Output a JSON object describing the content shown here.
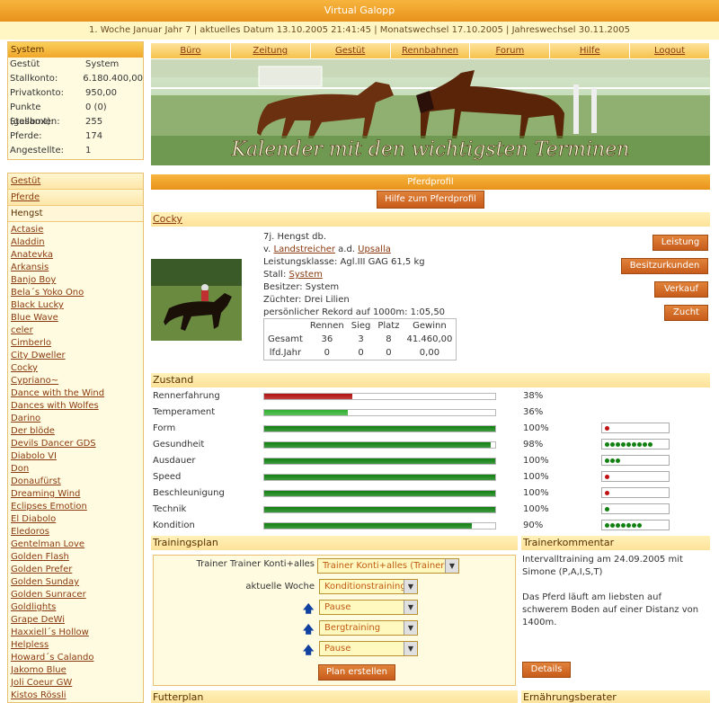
{
  "app": {
    "title": "Virtual Galopp",
    "datebar": "1. Woche Januar Jahr 7 | aktuelles Datum 13.10.2005 21:41:45 | Monatswechsel 17.10.2005 | Jahreswechsel 30.11.2005"
  },
  "system": {
    "title": "System",
    "rows": [
      {
        "label": "Gestüt",
        "value": "System"
      },
      {
        "label": "Stallkonto:",
        "value": "6.180.400,00"
      },
      {
        "label": "Privatkonto:",
        "value": "950,00"
      },
      {
        "label": "Punkte (gesamt):",
        "value": "0 (0)"
      },
      {
        "label": "Stallboxen:",
        "value": "255"
      },
      {
        "label": "Pferde:",
        "value": "174"
      },
      {
        "label": "Angestellte:",
        "value": "1"
      }
    ]
  },
  "nav": {
    "gestuet": "Gestüt",
    "pferde": "Pferde",
    "hengst": "Hengst",
    "horses": [
      "Actasie",
      "Aladdin",
      "Anatevka",
      "Arkansis",
      "Banjo Boy",
      "Bela´s Yoko Ono",
      "Black Lucky",
      "Blue Wave",
      "celer",
      "Cimberlo",
      "City Dweller",
      "Cocky",
      "Cypriano~",
      "Dance with the Wind",
      "Dances with Wolfes",
      "Darino",
      "Der blöde",
      "Devils Dancer GDS",
      "Diabolo VI",
      "Don",
      "Donaufürst",
      "Dreaming Wind",
      "Eclipses Emotion",
      "El Diabolo",
      "Eledoros",
      "Gentelman Love",
      "Golden Flash",
      "Golden Prefer",
      "Golden Sunday",
      "Golden Sunracer",
      "Goldlights",
      "Grape DeWi",
      "Haxxiell´s Hollow",
      "Helpless",
      "Howard´s Calando",
      "Jakomo Blue",
      "Joli Coeur GW",
      "Kistos Rössli"
    ]
  },
  "menu": [
    "Büro",
    "Zeitung",
    "Gestüt",
    "Rennbahnen",
    "Forum",
    "Hilfe",
    "Logout"
  ],
  "banner": {
    "caption": "Kalender mit den wichtigsten Terminen"
  },
  "profile": {
    "title": "Pferdprofil",
    "help_btn": "Hilfe zum Pferdprofil",
    "name": "Cocky",
    "line1": "7j. Hengst db.",
    "sire_prefix": "v.",
    "sire": "Landstreicher",
    "dam_prefix": "a.d.",
    "dam": "Upsalla",
    "klasse": "Leistungsklasse: Agl.III GAG 61,5 kg",
    "stall_label": "Stall:",
    "stall": "System",
    "besitzer": "Besitzer: System",
    "zuechter": "Züchter: Drei Lilien",
    "rekord": "persönlicher Rekord auf 1000m: 1:05,50",
    "buttons": [
      "Leistung",
      "Besitzurkunden",
      "Verkauf",
      "Zucht"
    ],
    "stats": {
      "headers": [
        "",
        "Rennen",
        "Sieg",
        "Platz",
        "Gewinn"
      ],
      "rows": [
        [
          "Gesamt",
          "36",
          "3",
          "8",
          "41.460,00"
        ],
        [
          "lfd.Jahr",
          "0",
          "0",
          "0",
          "0,00"
        ]
      ]
    }
  },
  "zustand": {
    "title": "Zustand",
    "items": [
      {
        "label": "Rennerfahrung",
        "pct": 38,
        "text": "38%",
        "color": "#b01010",
        "dots": 0
      },
      {
        "label": "Temperament",
        "pct": 36,
        "text": "36%",
        "color": "#30b030",
        "dots": 0
      },
      {
        "label": "Form",
        "pct": 100,
        "text": "100%",
        "color": "#108010",
        "dots": 1,
        "dotcolor": "#c01010"
      },
      {
        "label": "Gesundheit",
        "pct": 98,
        "text": "98%",
        "color": "#108010",
        "dots": 9,
        "dotcolor": "#108010"
      },
      {
        "label": "Ausdauer",
        "pct": 100,
        "text": "100%",
        "color": "#108010",
        "dots": 3,
        "dotcolor": "#108010"
      },
      {
        "label": "Speed",
        "pct": 100,
        "text": "100%",
        "color": "#108010",
        "dots": 1,
        "dotcolor": "#c01010"
      },
      {
        "label": "Beschleunigung",
        "pct": 100,
        "text": "100%",
        "color": "#108010",
        "dots": 1,
        "dotcolor": "#c01010"
      },
      {
        "label": "Technik",
        "pct": 100,
        "text": "100%",
        "color": "#108010",
        "dots": 1,
        "dotcolor": "#108010"
      },
      {
        "label": "Kondition",
        "pct": 90,
        "text": "90%",
        "color": "#108010",
        "dots": 7,
        "dotcolor": "#108010"
      }
    ]
  },
  "training": {
    "title": "Trainingsplan",
    "trainer_label": "Trainer Trainer Konti+alles",
    "trainer_value": "Trainer Konti+alles (Trainer)",
    "woche_label": "aktuelle Woche",
    "woche_value": "Konditionstraining",
    "plans": [
      "Pause",
      "Bergtraining",
      "Pause"
    ],
    "submit": "Plan erstellen"
  },
  "kommentar": {
    "title": "Trainerkommentar",
    "text1": "Intervalltraining am 24.09.2005 mit Simone (P,A,I,S,T)",
    "text2": "Das Pferd läuft am liebsten auf schwerem Boden auf einer Distanz von 1400m.",
    "details": "Details"
  },
  "futter": {
    "title": "Futterplan"
  },
  "ernaehrung": {
    "title": "Ernährungsberater"
  }
}
